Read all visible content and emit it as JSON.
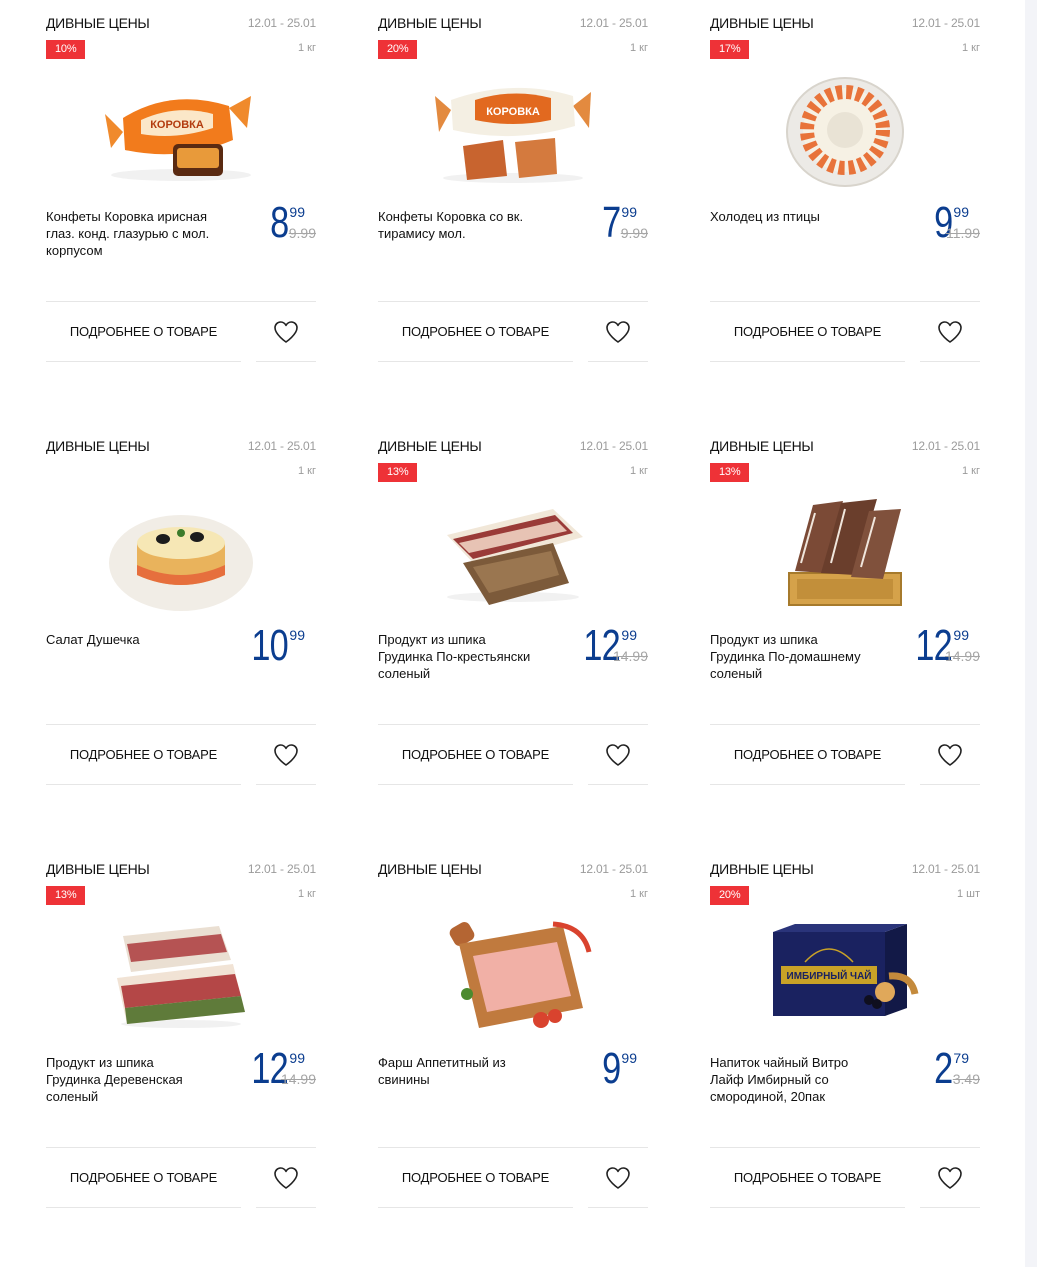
{
  "colors": {
    "accent_blue": "#0b3d8f",
    "discount_red": "#ee3237",
    "muted": "#9b9b9b"
  },
  "products": [
    {
      "promo": "ДИВНЫЕ ЦЕНЫ",
      "dates": "12.01 - 25.01",
      "badge": "10%",
      "unit": "1 кг",
      "image": "caramel-candy",
      "name": "Конфеты Коровка ирисная глаз. конд. глазурью с мол. корпусом",
      "price_int": "8",
      "price_cents": "99",
      "old_price": "9.99",
      "more_label": "ПОДРОБНЕЕ О ТОВАРЕ",
      "favorite_icon": "heart-icon"
    },
    {
      "promo": "ДИВНЫЕ ЦЕНЫ",
      "dates": "12.01 - 25.01",
      "badge": "20%",
      "unit": "1 кг",
      "image": "tiramisu-candy",
      "name": "Конфеты Коровка со вк. тирамису мол.",
      "price_int": "7",
      "price_cents": "99",
      "old_price": "9.99",
      "more_label": "ПОДРОБНЕЕ О ТОВАРЕ",
      "favorite_icon": "heart-icon"
    },
    {
      "promo": "ДИВНЫЕ ЦЕНЫ",
      "dates": "12.01 - 25.01",
      "badge": "17%",
      "unit": "1 кг",
      "image": "aspic-plate",
      "name": "Холодец из птицы",
      "price_int": "9",
      "price_cents": "99",
      "old_price": "11.99",
      "more_label": "ПОДРОБНЕЕ О ТОВАРЕ",
      "favorite_icon": "heart-icon"
    },
    {
      "promo": "ДИВНЫЕ ЦЕНЫ",
      "dates": "12.01 - 25.01",
      "badge": "",
      "unit": "1 кг",
      "image": "salad-plate",
      "name": "Салат Душечка",
      "price_int": "10",
      "price_cents": "99",
      "old_price": "",
      "more_label": "ПОДРОБНЕЕ О ТОВАРЕ",
      "favorite_icon": "heart-icon"
    },
    {
      "promo": "ДИВНЫЕ ЦЕНЫ",
      "dates": "12.01 - 25.01",
      "badge": "13%",
      "unit": "1 кг",
      "image": "bacon-slab",
      "name": "Продукт из шпика Грудинка По-крестьянски соленый",
      "price_int": "12",
      "price_cents": "99",
      "old_price": "14.99",
      "more_label": "ПОДРОБНЕЕ О ТОВАРЕ",
      "favorite_icon": "heart-icon"
    },
    {
      "promo": "ДИВНЫЕ ЦЕНЫ",
      "dates": "12.01 - 25.01",
      "badge": "13%",
      "unit": "1 кг",
      "image": "bacon-crate",
      "name": "Продукт из шпика Грудинка По-домашнему соленый",
      "price_int": "12",
      "price_cents": "99",
      "old_price": "14.99",
      "more_label": "ПОДРОБНЕЕ О ТОВАРЕ",
      "favorite_icon": "heart-icon"
    },
    {
      "promo": "ДИВНЫЕ ЦЕНЫ",
      "dates": "12.01 - 25.01",
      "badge": "13%",
      "unit": "1 кг",
      "image": "bacon-herbs",
      "name": "Продукт из шпика Грудинка Деревенская соленый",
      "price_int": "12",
      "price_cents": "99",
      "old_price": "14.99",
      "more_label": "ПОДРОБНЕЕ О ТОВАРЕ",
      "favorite_icon": "heart-icon"
    },
    {
      "promo": "ДИВНЫЕ ЦЕНЫ",
      "dates": "12.01 - 25.01",
      "badge": "",
      "unit": "1 кг",
      "image": "minced-meat-board",
      "name": "Фарш Аппетитный из свинины",
      "price_int": "9",
      "price_cents": "99",
      "old_price": "",
      "more_label": "ПОДРОБНЕЕ О ТОВАРЕ",
      "favorite_icon": "heart-icon"
    },
    {
      "promo": "ДИВНЫЕ ЦЕНЫ",
      "dates": "12.01 - 25.01",
      "badge": "20%",
      "unit": "1 шт",
      "image": "tea-box",
      "name": "Напиток чайный Витро Лайф Имбирный со смородиной, 20пак",
      "price_int": "2",
      "price_cents": "79",
      "old_price": "3.49",
      "box_text": "ИМБИРНЫЙ ЧАЙ",
      "more_label": "ПОДРОБНЕЕ О ТОВАРЕ",
      "favorite_icon": "heart-icon"
    }
  ]
}
